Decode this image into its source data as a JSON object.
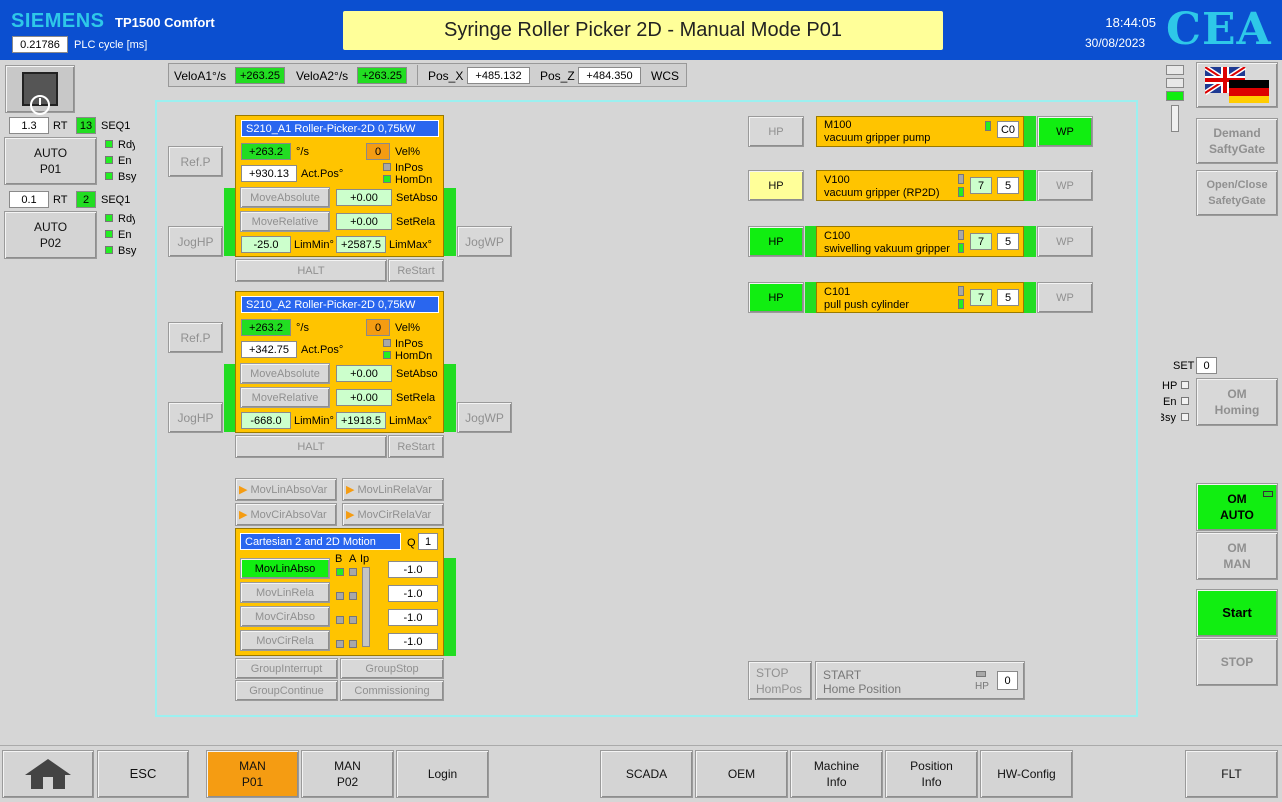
{
  "header": {
    "brand": "SIEMENS",
    "model": "TP1500 Comfort",
    "plc_cycle_value": "0.21786",
    "plc_cycle_label": "PLC cycle [ms]",
    "title": "Syringe Roller Picker 2D - Manual Mode P01",
    "time": "18:44:05",
    "date": "30/08/2023",
    "logo": "CEA",
    "colors": {
      "header_bg": "#0b4fd0",
      "title_bg": "#ffff99",
      "green": "#22dd22",
      "orange": "#f59c12",
      "yellow": "#ffc400"
    }
  },
  "statusbar": {
    "velo_a1_label": "VeloA1°/s",
    "velo_a1": "+263.25",
    "velo_a2_label": "VeloA2°/s",
    "velo_a2": "+263.25",
    "pos_x_label": "Pos_X",
    "pos_x": "+485.132",
    "pos_z_label": "Pos_Z",
    "pos_z": "+484.350",
    "frame": "WCS"
  },
  "left": {
    "seq1": {
      "rt_value": "1.3",
      "rt_label": "RT",
      "seq_num": "13",
      "seq_label": "SEQ1",
      "button": "AUTO\nP01"
    },
    "seq2": {
      "rt_value": "0.1",
      "rt_label": "RT",
      "seq_num": "2",
      "seq_label": "SEQ1",
      "button": "AUTO\nP02"
    },
    "status_labels": [
      "Rdy",
      "En",
      "Bsy"
    ]
  },
  "axis1": {
    "title": "S210_A1 Roller-Picker-2D 0,75kW",
    "vel": "+263.2",
    "vel_unit": "°/s",
    "vel_pct": "0",
    "vel_pct_label": "Vel%",
    "act_pos": "+930.13",
    "act_pos_label": "Act.Pos°",
    "inpos": "InPos",
    "homdn": "HomDn",
    "move_abs": "MoveAbsolute",
    "set_abs": "+0.00",
    "set_abs_label": "SetAbso",
    "move_rel": "MoveRelative",
    "set_rel": "+0.00",
    "set_rel_label": "SetRela",
    "lim_min": "-25.0",
    "lim_min_label": "LimMin°",
    "lim_max": "+2587.5",
    "lim_max_label": "LimMax°",
    "halt": "HALT",
    "restart": "ReStart",
    "ref": "Ref.P",
    "jog_hp": "JogHP",
    "jog_wp": "JogWP"
  },
  "axis2": {
    "title": "S210_A2 Roller-Picker-2D 0,75kW",
    "vel": "+263.2",
    "vel_unit": "°/s",
    "vel_pct": "0",
    "vel_pct_label": "Vel%",
    "act_pos": "+342.75",
    "act_pos_label": "Act.Pos°",
    "inpos": "InPos",
    "homdn": "HomDn",
    "move_abs": "MoveAbsolute",
    "set_abs": "+0.00",
    "set_abs_label": "SetAbso",
    "move_rel": "MoveRelative",
    "set_rel": "+0.00",
    "set_rel_label": "SetRela",
    "lim_min": "-668.0",
    "lim_min_label": "LimMin°",
    "lim_max": "+1918.5",
    "lim_max_label": "LimMax°",
    "halt": "HALT",
    "restart": "ReStart",
    "ref": "Ref.P",
    "jog_hp": "JogHP",
    "jog_wp": "JogWP"
  },
  "cartesian": {
    "var_buttons": [
      "MovLinAbsoVar",
      "MovLinRelaVar",
      "MovCirAbsoVar",
      "MovCirRelaVar"
    ],
    "title": "Cartesian 2 and 2D Motion",
    "q_label": "Q",
    "q_value": "1",
    "col_labels": [
      "B",
      "A",
      "Ip"
    ],
    "moves": [
      {
        "label": "MovLinAbso",
        "value": "-1.0"
      },
      {
        "label": "MovLinRela",
        "value": "-1.0"
      },
      {
        "label": "MovCirAbso",
        "value": "-1.0"
      },
      {
        "label": "MovCirRela",
        "value": "-1.0"
      }
    ],
    "group_buttons": [
      "GroupInterrupt",
      "GroupStop",
      "GroupContinue",
      "Commissioning"
    ]
  },
  "actuators": [
    {
      "hp": "HP",
      "code": "M100",
      "desc": "vacuum gripper pump",
      "count": "C0",
      "wp": "WP"
    },
    {
      "hp": "HP",
      "code": "V100",
      "desc": "vacuum gripper (RP2D)",
      "n1": "7",
      "n2": "5",
      "wp": "WP"
    },
    {
      "hp": "HP",
      "code": "C100",
      "desc": "swivelling vakuum gripper",
      "n1": "7",
      "n2": "5",
      "wp": "WP"
    },
    {
      "hp": "HP",
      "code": "C101",
      "desc": "pull push cylinder",
      "n1": "7",
      "n2": "5",
      "wp": "WP"
    }
  ],
  "homing": {
    "stop": "STOP\nHomPos",
    "start_line1": "START",
    "start_line2": "Home Position",
    "hp_label": "HP",
    "hp_value": "0"
  },
  "right": {
    "demand": "Demand\nSaftyGate",
    "openclose": "Open/Close\nSafetyGate",
    "set_label": "SET",
    "set_value": "0",
    "status_labels": [
      "HP",
      "En",
      "Bsy"
    ],
    "om_homing": "OM\nHoming",
    "om_auto": "OM\nAUTO",
    "om_man": "OM\nMAN",
    "start": "Start",
    "stop": "STOP"
  },
  "footer": {
    "esc": "ESC",
    "man_p01": "MAN\nP01",
    "man_p02": "MAN\nP02",
    "login": "Login",
    "scada": "SCADA",
    "oem": "OEM",
    "machine_info": "Machine\nInfo",
    "position_info": "Position\nInfo",
    "hw_config": "HW-Config",
    "flt": "FLT"
  }
}
